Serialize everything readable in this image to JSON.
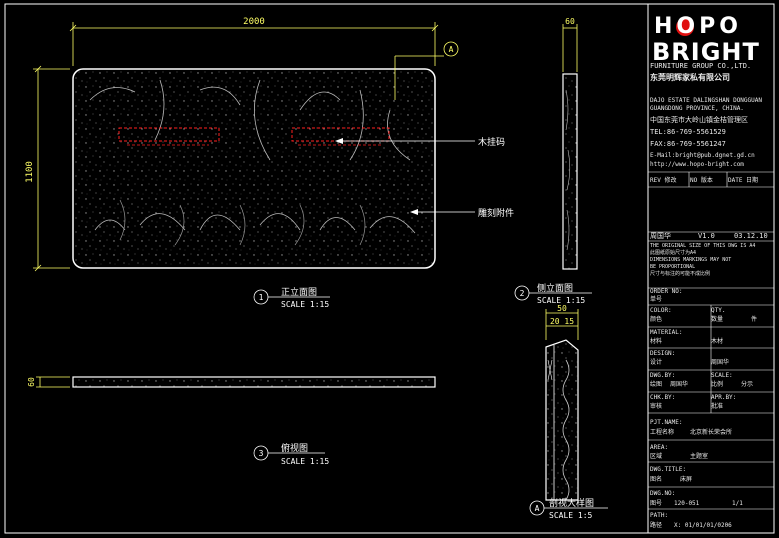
{
  "dims": {
    "width": "2000",
    "height": "1100",
    "side_top": "60",
    "plan_side": "60",
    "detail_a": "50",
    "detail_b": "20 15"
  },
  "views": {
    "front": {
      "num": "1",
      "title": "正立面图",
      "scale": "SCALE 1:15"
    },
    "side": {
      "num": "2",
      "title": "侧立面图",
      "scale": "SCALE 1:15"
    },
    "plan": {
      "num": "3",
      "title": "俯视图",
      "scale": "SCALE 1:15"
    },
    "detail": {
      "num": "A",
      "title": "剖视大样图",
      "scale": "SCALE 1:5"
    }
  },
  "callouts": {
    "wood_peg": "木挂码",
    "carving": "雕刻附件",
    "section_mark": "A"
  },
  "brand": {
    "logo_top": "HOPO",
    "logo_bottom": "BRIGHT",
    "group_en": "FURNITURE GROUP CO.,LTD.",
    "group_cn": "东莞明辉家私有限公司",
    "addr1": "DAJO ESTATE DALINGSHAN DONGGUAN",
    "addr2": "GUANGDONG PROVINCE, CHINA.",
    "addr_cn": "中国东莞市大岭山镇金桔管理区",
    "tel": "TEL:86-769-5561529",
    "fax": "FAX:86-769-5561247",
    "email": "E-Mail:bright@pub.dgnet.gd.cn",
    "web": "http://www.hopo-bright.com"
  },
  "revision": {
    "header": [
      "REV 修改",
      "NO 版本",
      "DATE 日期"
    ],
    "row_author": "周国华",
    "row_version": "V1.0",
    "row_date": "03.12.10"
  },
  "notes": {
    "line1": "THE ORIGINAL SIZE OF THIS DWG IS A4",
    "line2": "此图纸原始尺寸为A4",
    "line3": "DIMENSIONS MARKINGS MAY NOT",
    "line4": "BE PROPORTIONAL",
    "line5": "尺寸与标注的可能不成比例"
  },
  "fields": {
    "order_no": "ORDER NO:",
    "order_no_cn": "单号",
    "color": "COLOR:",
    "color_cn": "颜色",
    "qty": "QTY.",
    "qty_cn": "数量",
    "qty_val": "件",
    "material": "MATERIAL:",
    "material_cn": "材料",
    "material_val": "木材",
    "design": "DESIGN:",
    "design_cn": "设计",
    "design_val": "周国华",
    "dwg_by": "DWG.BY:",
    "dwg_by_cn": "绘图",
    "dwg_by_val": "周国华",
    "scale_lbl": "SCALE:",
    "scale_cn": "比例",
    "scale_val": "分示",
    "chk_by": "CHK.BY:",
    "chk_by_cn": "审核",
    "apr_by": "APR.BY:",
    "apr_by_cn": "批准",
    "project": "PJT.NAME:",
    "project_cn": "工程名称",
    "project_val": "北京新长荣会所",
    "area": "AREA:",
    "area_cn": "区域",
    "area_val": "主题室",
    "dwg_title": "DWG.TITLE:",
    "dwg_title_cn": "图名",
    "dwg_title_val": "床屏",
    "dwg_no": "DWG.NO:",
    "dwg_no_cn": "图号",
    "dwg_no_val": "120-051",
    "sheet": "1/1",
    "path": "PATH:",
    "path_cn": "路径",
    "path_val": "X: 01/01/01/0206"
  },
  "colors": {
    "line": "#ffffff",
    "dim": "#ffff66",
    "hidden": "#ff2020",
    "leader": "#ffffff",
    "border": "#ffffff"
  }
}
